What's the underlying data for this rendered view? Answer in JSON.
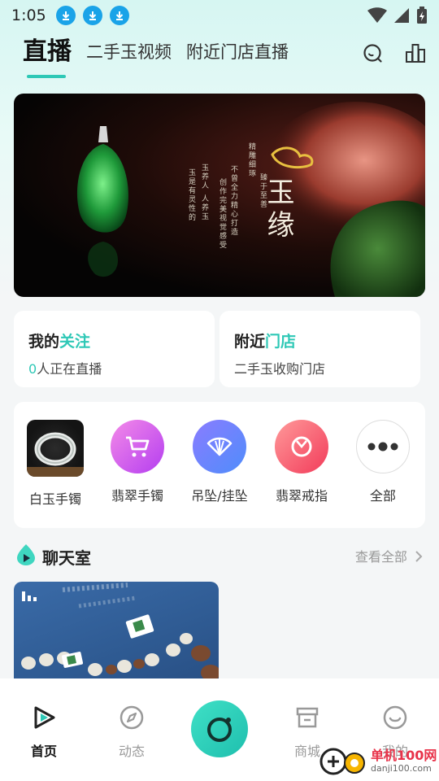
{
  "status_bar": {
    "time": "1:05"
  },
  "header": {
    "tabs": [
      {
        "label": "直播",
        "active": true
      },
      {
        "label": "二手玉视频",
        "active": false
      },
      {
        "label": "附近门店直播",
        "active": false
      }
    ],
    "icons": [
      "search-icon",
      "ranking-icon"
    ]
  },
  "banner": {
    "title": "玉缘",
    "lines": [
      "精雕细琢",
      "臻于至善",
      "不曾全力精心打造",
      "创作完美视觉感受",
      "玉养人 人养玉",
      "玉是有灵性的"
    ]
  },
  "quick_cards": [
    {
      "title_prefix": "我的",
      "title_highlight": "关注",
      "count": "0",
      "subtitle": "人正在直播"
    },
    {
      "title_prefix": "附近",
      "title_highlight": "门店",
      "subtitle": "二手玉收购门店"
    }
  ],
  "categories": [
    {
      "label": "白玉手镯",
      "icon": "bracelet-photo"
    },
    {
      "label": "翡翠手镯",
      "icon": "cart-icon"
    },
    {
      "label": "吊坠/挂坠",
      "icon": "fan-icon"
    },
    {
      "label": "翡翠戒指",
      "icon": "ring-icon"
    },
    {
      "label": "全部",
      "icon": "more-icon"
    }
  ],
  "chat_room": {
    "title": "聊天室",
    "see_all": "查看全部"
  },
  "bottom_nav": [
    {
      "label": "首页",
      "icon": "play-icon",
      "active": true
    },
    {
      "label": "动态",
      "icon": "compass-icon",
      "active": false
    },
    {
      "label": "",
      "icon": "camera-icon",
      "active": false
    },
    {
      "label": "商城",
      "icon": "store-icon",
      "active": false
    },
    {
      "label": "我的",
      "icon": "smile-icon",
      "active": false
    }
  ],
  "watermark": {
    "cn": "单机100网",
    "url": "danji100.com"
  },
  "colors": {
    "accent": "#2ec8b6",
    "download_badge": "#1aa3e8"
  }
}
